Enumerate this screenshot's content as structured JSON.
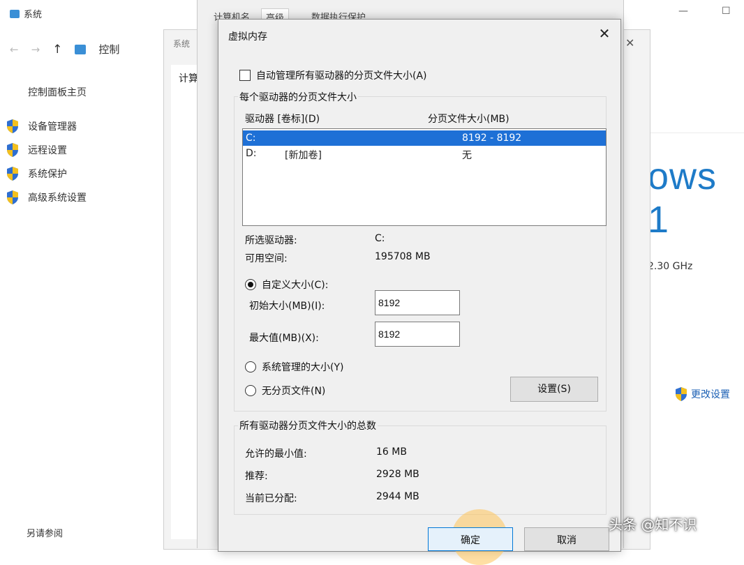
{
  "background": {
    "title": "系统",
    "nav_crumb": "控制",
    "side_home": "控制面板主页",
    "side_items": [
      {
        "label": "设备管理器",
        "icon": "shield-icon"
      },
      {
        "label": "远程设置",
        "icon": "shield-icon"
      },
      {
        "label": "系统保护",
        "icon": "shield-icon"
      },
      {
        "label": "高级系统设置",
        "icon": "shield-icon"
      }
    ],
    "side_footer": "另请参阅",
    "brand_fragment": "ows 1",
    "cpu_speed": "2.30 GHz",
    "change_settings": "更改设置"
  },
  "mid_window": {
    "title": "系统",
    "tab": "计算"
  },
  "props_window": {
    "tabs": [
      "计算机名",
      "高级",
      "数据执行保护"
    ]
  },
  "vm": {
    "title": "虚拟内存",
    "auto_manage_label": "自动管理所有驱动器的分页文件大小(A)",
    "per_drive_group": "每个驱动器的分页文件大小",
    "col_drive": "驱动器 [卷标](D)",
    "col_size": "分页文件大小(MB)",
    "drives": [
      {
        "drive": "C:",
        "label": "",
        "size": "8192 - 8192",
        "selected": true
      },
      {
        "drive": "D:",
        "label": "[新加卷]",
        "size": "无",
        "selected": false
      }
    ],
    "selected_drive_label": "所选驱动器:",
    "selected_drive_value": "C:",
    "free_space_label": "可用空间:",
    "free_space_value": "195708 MB",
    "custom_size_label": "自定义大小(C):",
    "initial_size_label": "初始大小(MB)(I):",
    "initial_size_value": "8192",
    "max_size_label": "最大值(MB)(X):",
    "max_size_value": "8192",
    "system_managed_label": "系统管理的大小(Y)",
    "no_paging_label": "无分页文件(N)",
    "set_button": "设置(S)",
    "total_group": "所有驱动器分页文件大小的总数",
    "min_allowed_label": "允许的最小值:",
    "min_allowed_value": "16 MB",
    "recommended_label": "推荐:",
    "recommended_value": "2928 MB",
    "current_label": "当前已分配:",
    "current_value": "2944 MB",
    "ok_button": "确定",
    "cancel_button": "取消"
  },
  "watermark": "头条 @知不识",
  "colors": {
    "selection": "#1e70d6",
    "dialog_bg": "#f0f0f0",
    "brand_blue": "#1e7bc8"
  }
}
